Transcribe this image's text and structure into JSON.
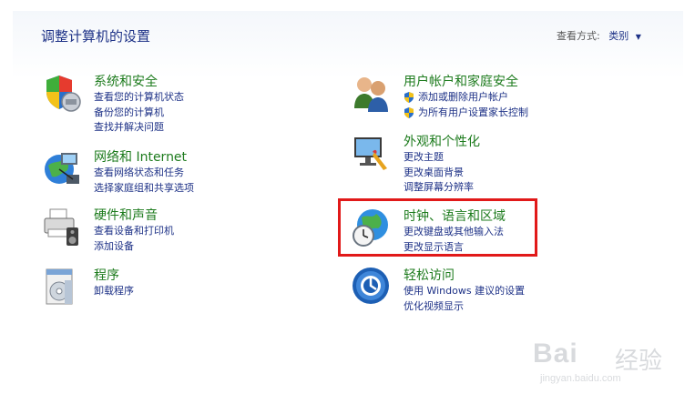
{
  "header": {
    "title": "调整计算机的设置",
    "view_by_label": "查看方式:",
    "view_by_value": "类别"
  },
  "left_column": [
    {
      "heading": "系统和安全",
      "icon": "shield-icon",
      "links": [
        "查看您的计算机状态",
        "备份您的计算机",
        "查找并解决问题"
      ]
    },
    {
      "heading": "网络和 Internet",
      "icon": "network-globe-icon",
      "links": [
        "查看网络状态和任务",
        "选择家庭组和共享选项"
      ]
    },
    {
      "heading": "硬件和声音",
      "icon": "printer-icon",
      "links": [
        "查看设备和打印机",
        "添加设备"
      ]
    },
    {
      "heading": "程序",
      "icon": "programs-icon",
      "links": [
        "卸载程序"
      ]
    }
  ],
  "right_column": [
    {
      "heading": "用户帐户和家庭安全",
      "icon": "users-icon",
      "links": [
        "添加或删除用户帐户",
        "为所有用户设置家长控制"
      ]
    },
    {
      "heading": "外观和个性化",
      "icon": "monitor-paint-icon",
      "links": [
        "更改主题",
        "更改桌面背景",
        "调整屏幕分辨率"
      ]
    },
    {
      "heading": "时钟、语言和区域",
      "icon": "globe-clock-icon",
      "links": [
        "更改键盘或其他输入法",
        "更改显示语言"
      ]
    },
    {
      "heading": "轻松访问",
      "icon": "ease-of-access-icon",
      "links": [
        "使用 Windows 建议的设置",
        "优化视频显示"
      ]
    }
  ],
  "watermark": {
    "brand": "Bai",
    "brand_cn": "经验",
    "url": "jingyan.baidu.com"
  },
  "colors": {
    "heading_green": "#1d7b1d",
    "link_blue": "#1e3287",
    "highlight_red": "#e11919"
  }
}
